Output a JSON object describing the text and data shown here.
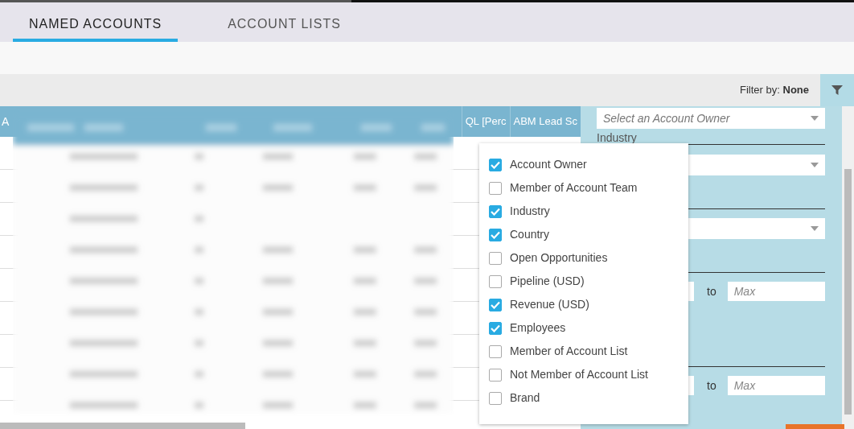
{
  "tabs": [
    {
      "label": "NAMED ACCOUNTS",
      "selected": true
    },
    {
      "label": "ACCOUNT LISTS",
      "selected": false
    }
  ],
  "toolbar": {
    "filter_label": "Filter by:",
    "filter_value": "None"
  },
  "table": {
    "columns": [
      "A",
      "QL [Perc",
      "ABM Lead Sc"
    ]
  },
  "filter_panel": {
    "owner_select": {
      "placeholder": "Select an Account Owner"
    },
    "industry_label": "Industry",
    "ranges": [
      {
        "to": "to",
        "max_placeholder": "Max"
      },
      {
        "to": "to",
        "max_placeholder": "Max"
      }
    ]
  },
  "column_menu": {
    "items": [
      {
        "label": "Account Owner",
        "checked": true
      },
      {
        "label": "Member of Account Team",
        "checked": false
      },
      {
        "label": "Industry",
        "checked": true
      },
      {
        "label": "Country",
        "checked": true
      },
      {
        "label": "Open Opportunities",
        "checked": false
      },
      {
        "label": "Pipeline (USD)",
        "checked": false
      },
      {
        "label": "Revenue (USD)",
        "checked": true
      },
      {
        "label": "Employees",
        "checked": true
      },
      {
        "label": "Member of Account List",
        "checked": false
      },
      {
        "label": "Not Member of Account List",
        "checked": false
      },
      {
        "label": "Brand",
        "checked": false
      }
    ]
  }
}
